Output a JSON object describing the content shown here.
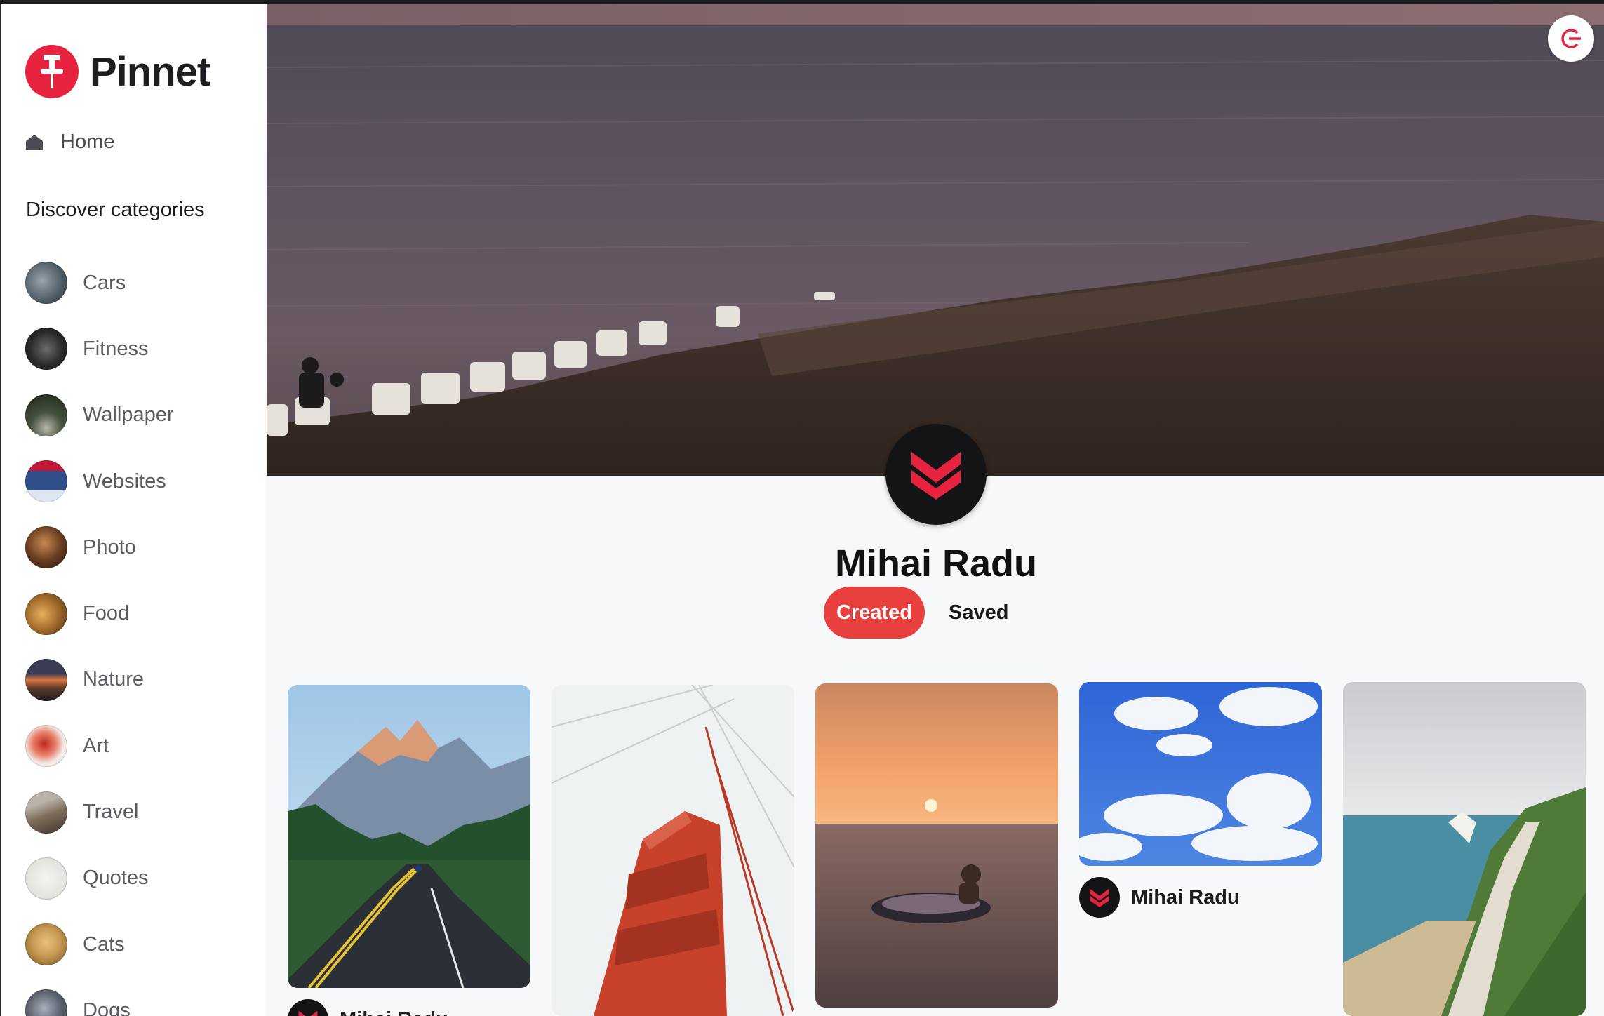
{
  "app": {
    "name": "Pinnet"
  },
  "sidebar": {
    "home_label": "Home",
    "discover_heading": "Discover categories",
    "categories": [
      {
        "label": "Cars",
        "color": "#6f7d86"
      },
      {
        "label": "Fitness",
        "color": "#3a3a3d"
      },
      {
        "label": "Wallpaper",
        "color": "#44513e"
      },
      {
        "label": "Websites",
        "color": "#2f4e8a"
      },
      {
        "label": "Photo",
        "color": "#6a3d22"
      },
      {
        "label": "Food",
        "color": "#a06a2c"
      },
      {
        "label": "Nature",
        "color": "#a35a3a"
      },
      {
        "label": "Art",
        "color": "#d6564a"
      },
      {
        "label": "Travel",
        "color": "#806e5c"
      },
      {
        "label": "Quotes",
        "color": "#e4e4e0"
      },
      {
        "label": "Cats",
        "color": "#c79a52"
      },
      {
        "label": "Dogs",
        "color": "#5d6470"
      }
    ]
  },
  "profile": {
    "name": "Mihai Radu",
    "tabs": {
      "created": "Created",
      "saved": "Saved"
    }
  },
  "pins": [
    {
      "author": "Mihai Radu"
    },
    {
      "author": "Mihai Radu"
    }
  ],
  "colors": {
    "accent": "#e8403e",
    "brand": "#e8233f"
  }
}
